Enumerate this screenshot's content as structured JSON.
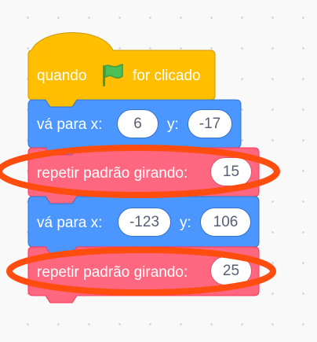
{
  "colors": {
    "event_fill": "#ffbf00",
    "event_stroke": "#cc9900",
    "motion_fill": "#4c97ff",
    "motion_stroke": "#3373cc",
    "custom_fill": "#ff6680",
    "custom_stroke": "#ff3355",
    "highlight_ring": "#ff4d0f",
    "flag_green": "#4cbf56"
  },
  "script": {
    "hat": {
      "label_before": "quando",
      "flag_icon": "green-flag-icon",
      "label_after": "for clicado"
    },
    "goto_1": {
      "label_x": "vá para x:",
      "x": "6",
      "label_y": "y:",
      "y": "-17"
    },
    "pattern_1": {
      "label": "repetir padrão girando:",
      "value": "15"
    },
    "goto_2": {
      "label_x": "vá para x:",
      "x": "-123",
      "label_y": "y:",
      "y": "106"
    },
    "pattern_2": {
      "label": "repetir padrão girando:",
      "value": "25"
    }
  }
}
